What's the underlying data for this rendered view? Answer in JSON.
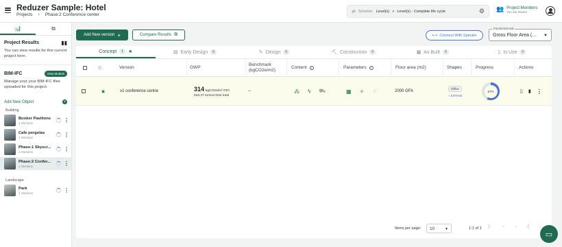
{
  "header": {
    "title": "Reduzer Sample: Hotel",
    "breadcrumb": [
      "Projects",
      "Phase:2 Conference center"
    ],
    "scheme_label": "Scheme:",
    "scheme_value": "Level(s)",
    "scheme_arrow": ">",
    "scheme_detail": "Level(s) - Complete life cycle",
    "members_title": "Project Members",
    "members_sub": "You are Owner"
  },
  "sidebar": {
    "project_results_title": "Project Results",
    "project_results_desc": "You can view results for this current project here.",
    "bim_title": "BIM-IFC",
    "view_models_label": "View Models",
    "bim_desc": "Manage your your BIM-IFC files uploaded for this project.",
    "add_object_label": "Add New Object",
    "categories": [
      {
        "label": "Building",
        "items": [
          {
            "name": "Booker Pavilions",
            "versions": "1 Versions"
          },
          {
            "name": "Cafe pergolas",
            "versions": "1 Versions"
          },
          {
            "name": "Phase:1 Skyscr...",
            "versions": "1 Versions"
          },
          {
            "name": "Phase:2 Confer...",
            "versions": "1 Versions"
          }
        ]
      },
      {
        "label": "Landscape",
        "items": [
          {
            "name": "Park",
            "versions": "1 Versions"
          }
        ]
      }
    ]
  },
  "toolbar": {
    "add_version_label": "Add New version",
    "compare_label": "Compare Results",
    "speckle_label": "Connect With Speckle",
    "functional_unit_label": "Functional unit",
    "functional_unit_value": "Gross Floor Area (..."
  },
  "phases": [
    {
      "label": "Concept",
      "count": "1"
    },
    {
      "label": "Early Design",
      "count": "0"
    },
    {
      "label": "Design",
      "count": "0"
    },
    {
      "label": "Construction",
      "count": "0"
    },
    {
      "label": "As Built",
      "count": "0"
    },
    {
      "label": "In Use",
      "count": "0"
    }
  ],
  "table": {
    "headers": {
      "version": "Version",
      "gwp": "GWP",
      "benchmark": "Benchmark (kgCO2e/m2)",
      "content": "Content",
      "parameters": "Parameters",
      "floor_area": "Floor area (m2)",
      "shapes": "Shapes",
      "progress": "Progress",
      "actions": "Actions"
    },
    "row": {
      "version": "v1 conference centre",
      "gwp_value": "314",
      "gwp_unit": "kgCO2e/m² GFA",
      "gwp_total": "628,37 tonneCO2e total",
      "benchmark": "--",
      "floor_area": "2000 GFA",
      "shape_tag": "Office",
      "expand": "+ EXPAND",
      "progress_pct": 57,
      "progress_label": "57%"
    }
  },
  "pager": {
    "items_per_page_label": "Items per page:",
    "items_per_page": "10",
    "range": "1-1 of 1"
  },
  "colors": {
    "brand": "#1f6a50",
    "accent_blue": "#4a73c9",
    "row_highlight": "#fbfcec"
  }
}
